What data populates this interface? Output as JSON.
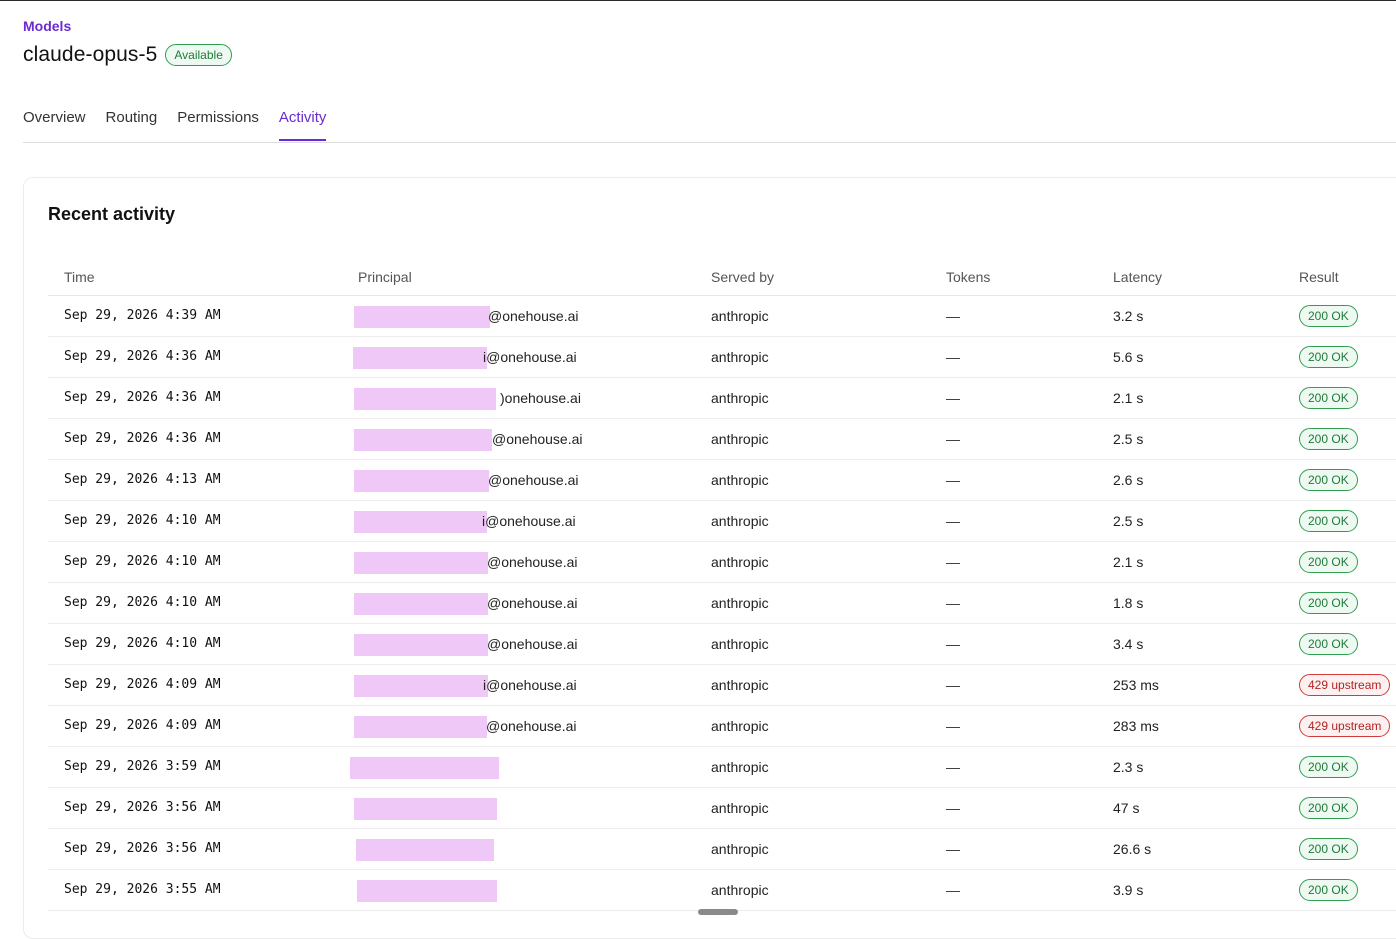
{
  "breadcrumb": "Models",
  "page": {
    "title": "claude-opus-5",
    "status": "Available"
  },
  "tabs": [
    {
      "label": "Overview",
      "active": false
    },
    {
      "label": "Routing",
      "active": false
    },
    {
      "label": "Permissions",
      "active": false
    },
    {
      "label": "Activity",
      "active": true
    }
  ],
  "activity": {
    "title": "Recent activity",
    "columns": [
      "Time",
      "Principal",
      "Served by",
      "Tokens",
      "Latency",
      "Result"
    ],
    "rows": [
      {
        "time": "Sep 29, 2026 4:39 AM",
        "principal_suffix": "@onehouse.ai",
        "served_by": "anthropic",
        "tokens": "—",
        "latency": "3.2 s",
        "result": "200 OK",
        "status": "ok"
      },
      {
        "time": "Sep 29, 2026 4:36 AM",
        "principal_suffix": "i@onehouse.ai",
        "served_by": "anthropic",
        "tokens": "—",
        "latency": "5.6 s",
        "result": "200 OK",
        "status": "ok"
      },
      {
        "time": "Sep 29, 2026 4:36 AM",
        "principal_suffix": ")onehouse.ai",
        "served_by": "anthropic",
        "tokens": "—",
        "latency": "2.1 s",
        "result": "200 OK",
        "status": "ok"
      },
      {
        "time": "Sep 29, 2026 4:36 AM",
        "principal_suffix": "@onehouse.ai",
        "served_by": "anthropic",
        "tokens": "—",
        "latency": "2.5 s",
        "result": "200 OK",
        "status": "ok"
      },
      {
        "time": "Sep 29, 2026 4:13 AM",
        "principal_suffix": "@onehouse.ai",
        "served_by": "anthropic",
        "tokens": "—",
        "latency": "2.6 s",
        "result": "200 OK",
        "status": "ok"
      },
      {
        "time": "Sep 29, 2026 4:10 AM",
        "principal_suffix": "i@onehouse.ai",
        "served_by": "anthropic",
        "tokens": "—",
        "latency": "2.5 s",
        "result": "200 OK",
        "status": "ok"
      },
      {
        "time": "Sep 29, 2026 4:10 AM",
        "principal_suffix": "@onehouse.ai",
        "served_by": "anthropic",
        "tokens": "—",
        "latency": "2.1 s",
        "result": "200 OK",
        "status": "ok"
      },
      {
        "time": "Sep 29, 2026 4:10 AM",
        "principal_suffix": "@onehouse.ai",
        "served_by": "anthropic",
        "tokens": "—",
        "latency": "1.8 s",
        "result": "200 OK",
        "status": "ok"
      },
      {
        "time": "Sep 29, 2026 4:10 AM",
        "principal_suffix": "@onehouse.ai",
        "served_by": "anthropic",
        "tokens": "—",
        "latency": "3.4 s",
        "result": "200 OK",
        "status": "ok"
      },
      {
        "time": "Sep 29, 2026 4:09 AM",
        "principal_suffix": "i@onehouse.ai",
        "served_by": "anthropic",
        "tokens": "—",
        "latency": "253 ms",
        "result": "429 upstream",
        "status": "err"
      },
      {
        "time": "Sep 29, 2026 4:09 AM",
        "principal_suffix": "@onehouse.ai",
        "served_by": "anthropic",
        "tokens": "—",
        "latency": "283 ms",
        "result": "429 upstream",
        "status": "err"
      },
      {
        "time": "Sep 29, 2026 3:59 AM",
        "principal_suffix": "",
        "served_by": "anthropic",
        "tokens": "—",
        "latency": "2.3 s",
        "result": "200 OK",
        "status": "ok"
      },
      {
        "time": "Sep 29, 2026 3:56 AM",
        "principal_suffix": "",
        "served_by": "anthropic",
        "tokens": "—",
        "latency": "47 s",
        "result": "200 OK",
        "status": "ok"
      },
      {
        "time": "Sep 29, 2026 3:56 AM",
        "principal_suffix": "",
        "served_by": "anthropic",
        "tokens": "—",
        "latency": "26.6 s",
        "result": "200 OK",
        "status": "ok"
      },
      {
        "time": "Sep 29, 2026 3:55 AM",
        "principal_suffix": "",
        "served_by": "anthropic",
        "tokens": "—",
        "latency": "3.9 s",
        "result": "200 OK",
        "status": "ok"
      }
    ]
  },
  "colors": {
    "accent": "#6b2bd0",
    "ok": "#1f7a3a",
    "error": "#b32323",
    "redaction": "#f0c8f8"
  }
}
